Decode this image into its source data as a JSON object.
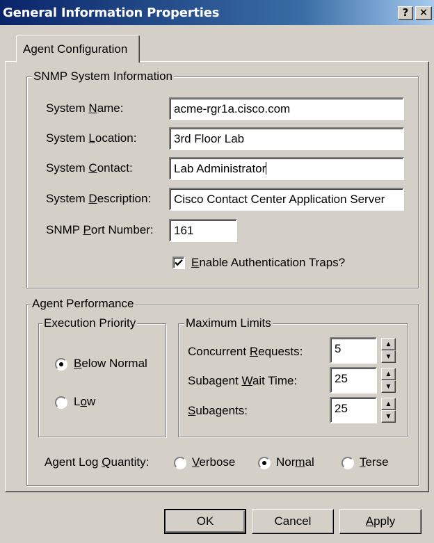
{
  "window": {
    "title": "General Information Properties",
    "help_glyph": "?",
    "close_glyph": "✕"
  },
  "tabs": [
    {
      "label": "Agent Configuration",
      "active": true
    }
  ],
  "snmp": {
    "group_label": "SNMP System Information",
    "name": {
      "label_pre": "System ",
      "label_key": "N",
      "label_post": "ame:",
      "value": "acme-rgr1a.cisco.com"
    },
    "location": {
      "label_pre": "System ",
      "label_key": "L",
      "label_post": "ocation:",
      "value": "3rd Floor Lab"
    },
    "contact": {
      "label_pre": "System ",
      "label_key": "C",
      "label_post": "ontact:",
      "value": "Lab Administrator"
    },
    "description": {
      "label_pre": "System ",
      "label_key": "D",
      "label_post": "escription:",
      "value": "Cisco Contact Center Application Server"
    },
    "port": {
      "label_pre": "SNMP ",
      "label_key": "P",
      "label_post": "ort Number:",
      "value": "161"
    },
    "auth_traps": {
      "label_key": "E",
      "label_post": "nable Authentication Traps?",
      "checked": true
    }
  },
  "performance": {
    "group_label": "Agent Performance",
    "priority": {
      "group_label": "Execution Priority",
      "options": [
        {
          "label_key": "B",
          "label_post": "elow Normal",
          "selected": true
        },
        {
          "label_pre": "L",
          "label_key": "o",
          "label_post": "w",
          "selected": false
        }
      ]
    },
    "limits": {
      "group_label": "Maximum Limits",
      "concurrent": {
        "label_pre": "Concurrent ",
        "label_key": "R",
        "label_post": "equests:",
        "value": "5"
      },
      "wait": {
        "label_pre": "Subagent ",
        "label_key": "W",
        "label_post": "ait Time:",
        "value": "25"
      },
      "subagents": {
        "label_key": "S",
        "label_post": "ubagents:",
        "value": "25"
      },
      "spin_up": "▲",
      "spin_down": "▼"
    },
    "log": {
      "label_pre": "Agent Log ",
      "label_key": "Q",
      "label_post": "uantity:",
      "options": [
        {
          "label_key": "V",
          "label_post": "erbose",
          "selected": false
        },
        {
          "label_pre": "Nor",
          "label_key": "m",
          "label_post": "al",
          "selected": true
        },
        {
          "label_key": "T",
          "label_post": "erse",
          "selected": false
        }
      ]
    }
  },
  "buttons": {
    "ok": "OK",
    "cancel": "Cancel",
    "apply_key": "A",
    "apply_post": "pply"
  }
}
